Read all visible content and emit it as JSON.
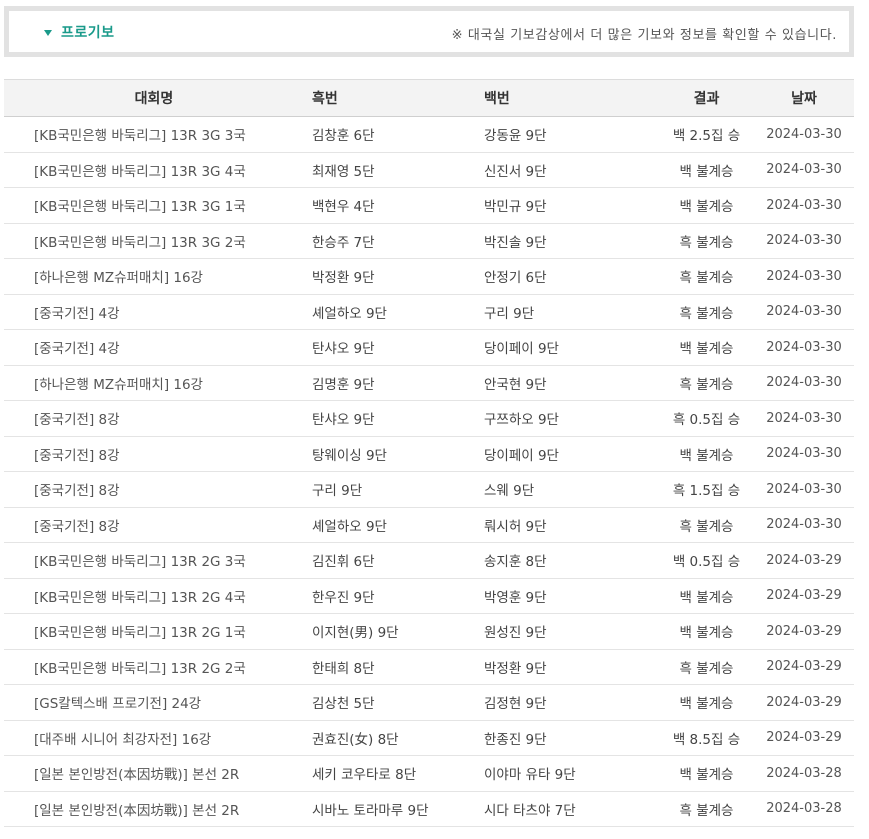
{
  "header": {
    "toggle_label": "프로기보",
    "note": "※ 대국실 기보감상에서 더 많은 기보와 정보를 확인할 수 있습니다."
  },
  "table": {
    "columns": [
      "대회명",
      "흑번",
      "백번",
      "결과",
      "날짜"
    ],
    "rows": [
      {
        "tournament": "[KB국민은행 바둑리그] 13R 3G 3국",
        "black": "김창훈 6단",
        "white": "강동윤 9단",
        "result": "백 2.5집 승",
        "date": "2024-03-30"
      },
      {
        "tournament": "[KB국민은행 바둑리그] 13R 3G 4국",
        "black": "최재영 5단",
        "white": "신진서 9단",
        "result": "백 불계승",
        "date": "2024-03-30"
      },
      {
        "tournament": "[KB국민은행 바둑리그] 13R 3G 1국",
        "black": "백현우 4단",
        "white": "박민규 9단",
        "result": "백 불계승",
        "date": "2024-03-30"
      },
      {
        "tournament": "[KB국민은행 바둑리그] 13R 3G 2국",
        "black": "한승주 7단",
        "white": "박진솔 9단",
        "result": "흑 불계승",
        "date": "2024-03-30"
      },
      {
        "tournament": "[하나은행 MZ슈퍼매치] 16강",
        "black": "박정환 9단",
        "white": "안정기 6단",
        "result": "흑 불계승",
        "date": "2024-03-30"
      },
      {
        "tournament": "[중국기전] 4강",
        "black": "셰얼하오 9단",
        "white": "구리 9단",
        "result": "흑 불계승",
        "date": "2024-03-30"
      },
      {
        "tournament": "[중국기전] 4강",
        "black": "탄샤오 9단",
        "white": "당이페이 9단",
        "result": "백 불계승",
        "date": "2024-03-30"
      },
      {
        "tournament": "[하나은행 MZ슈퍼매치] 16강",
        "black": "김명훈 9단",
        "white": "안국현 9단",
        "result": "흑 불계승",
        "date": "2024-03-30"
      },
      {
        "tournament": "[중국기전] 8강",
        "black": "탄샤오 9단",
        "white": "구쯔하오 9단",
        "result": "흑 0.5집 승",
        "date": "2024-03-30"
      },
      {
        "tournament": "[중국기전] 8강",
        "black": "탕웨이싱 9단",
        "white": "당이페이 9단",
        "result": "백 불계승",
        "date": "2024-03-30"
      },
      {
        "tournament": "[중국기전] 8강",
        "black": "구리 9단",
        "white": "스웨 9단",
        "result": "흑 1.5집 승",
        "date": "2024-03-30"
      },
      {
        "tournament": "[중국기전] 8강",
        "black": "셰얼하오 9단",
        "white": "뤄시허 9단",
        "result": "흑 불계승",
        "date": "2024-03-30"
      },
      {
        "tournament": "[KB국민은행 바둑리그] 13R 2G 3국",
        "black": "김진휘 6단",
        "white": "송지훈 8단",
        "result": "백 0.5집 승",
        "date": "2024-03-29"
      },
      {
        "tournament": "[KB국민은행 바둑리그] 13R 2G 4국",
        "black": "한우진 9단",
        "white": "박영훈 9단",
        "result": "백 불계승",
        "date": "2024-03-29"
      },
      {
        "tournament": "[KB국민은행 바둑리그] 13R 2G 1국",
        "black": "이지현(男) 9단",
        "white": "원성진 9단",
        "result": "백 불계승",
        "date": "2024-03-29"
      },
      {
        "tournament": "[KB국민은행 바둑리그] 13R 2G 2국",
        "black": "한태희 8단",
        "white": "박정환 9단",
        "result": "흑 불계승",
        "date": "2024-03-29"
      },
      {
        "tournament": "[GS칼텍스배 프로기전] 24강",
        "black": "김상천 5단",
        "white": "김정현 9단",
        "result": "백 불계승",
        "date": "2024-03-29"
      },
      {
        "tournament": "[대주배 시니어 최강자전] 16강",
        "black": "권효진(女) 8단",
        "white": "한종진 9단",
        "result": "백 8.5집 승",
        "date": "2024-03-29"
      },
      {
        "tournament": "[일본 본인방전(本因坊戰)] 본선 2R",
        "black": "세키 코우타로 8단",
        "white": "이야마 유타 9단",
        "result": "백 불계승",
        "date": "2024-03-28"
      },
      {
        "tournament": "[일본 본인방전(本因坊戰)] 본선 2R",
        "black": "시바노 토라마루 9단",
        "white": "시다 타츠야 7단",
        "result": "흑 불계승",
        "date": "2024-03-28"
      }
    ]
  },
  "colors": {
    "accent": "#1a9a8a",
    "header_bg": "#f3f3f3",
    "border": "#e2e2e2"
  }
}
